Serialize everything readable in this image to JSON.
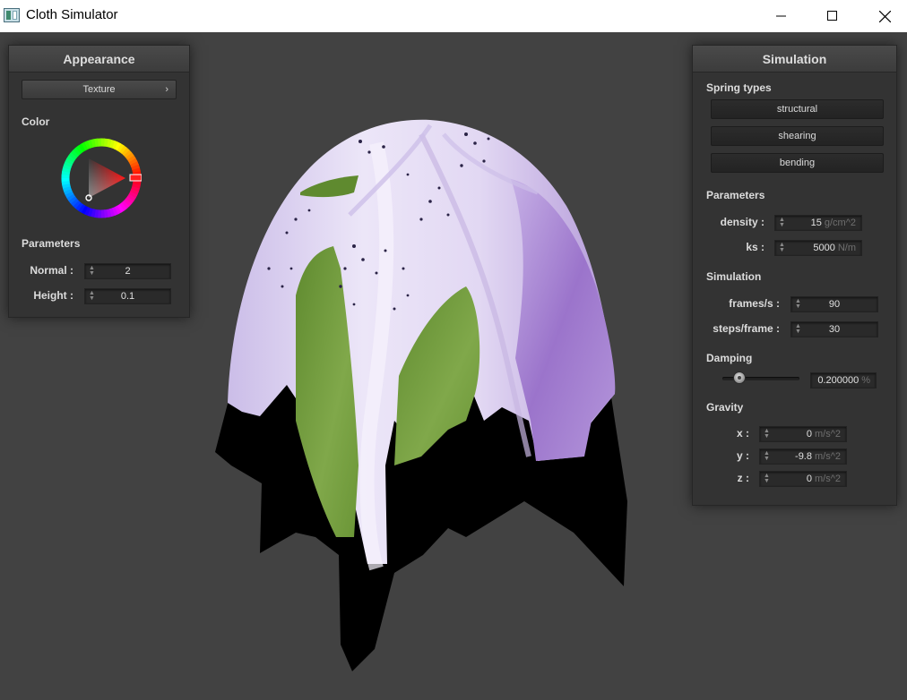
{
  "window": {
    "title": "Cloth Simulator",
    "app_icon": "app-window-icon",
    "controls": {
      "minimize_icon": "minimize-icon",
      "maximize_icon": "maximize-icon",
      "close_icon": "close-icon"
    }
  },
  "appearance": {
    "title": "Appearance",
    "texture_button": "Texture",
    "texture_chevron": "›",
    "color_label": "Color",
    "color_wheel": {
      "selected_hue": "#ff0000",
      "icon": "color-wheel-icon"
    },
    "parameters_label": "Parameters",
    "normal": {
      "label": "Normal :",
      "value": "2"
    },
    "height": {
      "label": "Height :",
      "value": "0.1"
    }
  },
  "simulation": {
    "title": "Simulation",
    "spring_types_label": "Spring types",
    "spring_types": [
      "structural",
      "shearing",
      "bending"
    ],
    "parameters_label": "Parameters",
    "density": {
      "label": "density :",
      "value": "15",
      "unit": "g/cm^2"
    },
    "ks": {
      "label": "ks :",
      "value": "5000",
      "unit": "N/m"
    },
    "simulation_label": "Simulation",
    "frames": {
      "label": "frames/s :",
      "value": "90"
    },
    "steps": {
      "label": "steps/frame :",
      "value": "30"
    },
    "damping_label": "Damping",
    "damping": {
      "value": "0.200000",
      "unit": "%",
      "slider_fraction": 0.2
    },
    "gravity_label": "Gravity",
    "gravity": {
      "x": {
        "label": "x :",
        "value": "0",
        "unit": "m/s^2"
      },
      "y": {
        "label": "y :",
        "value": "-9.8",
        "unit": "m/s^2"
      },
      "z": {
        "label": "z :",
        "value": "0",
        "unit": "m/s^2"
      }
    }
  },
  "colors": {
    "viewport_bg": "#424242",
    "panel_bg": "#333333",
    "cloth_lavender": "#e4dcf2",
    "cloth_purple": "#9a72c7",
    "leaf_green": "#6f9a3a"
  }
}
